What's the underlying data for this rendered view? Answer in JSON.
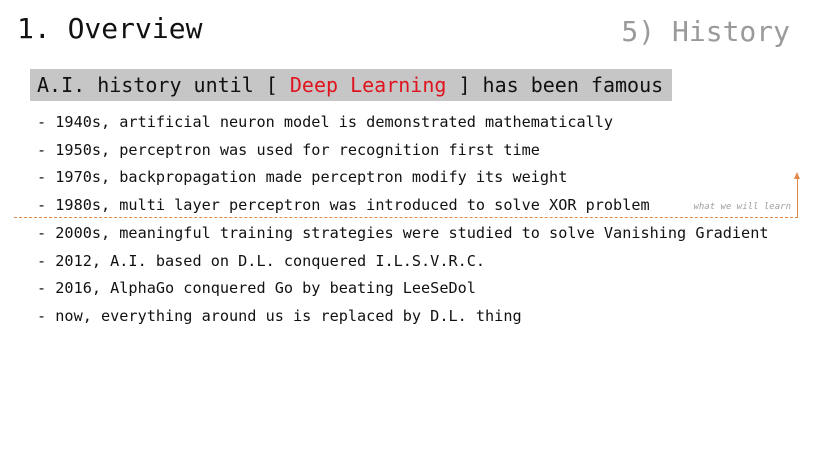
{
  "header": {
    "title": "1. Overview",
    "section": "5) History"
  },
  "headline": {
    "prefix": "A.I. history until [ ",
    "highlight": "Deep Learning",
    "suffix": " ] has been famous",
    "highlight_color": "#e0141e",
    "background_color": "#c6c6c6"
  },
  "items": [
    "- 1940s, artificial neuron model is demonstrated mathematically",
    "- 1950s, perceptron was used for recognition first time",
    "- 1970s, backpropagation made perceptron modify its weight",
    "- 1980s, multi layer perceptron was introduced to solve XOR problem",
    "- 2000s, meaningful training strategies were studied to solve Vanishing Gradient",
    "- 2012, A.I. based on D.L. conquered I.L.S.V.R.C.",
    "- 2016, AlphaGo conquered Go by beating LeeSeDol",
    "- now, everything around us is replaced by D.L. thing"
  ],
  "annotation": {
    "text": "what we will learn",
    "color": "#e0894a",
    "icon": "arrow-up-icon"
  }
}
